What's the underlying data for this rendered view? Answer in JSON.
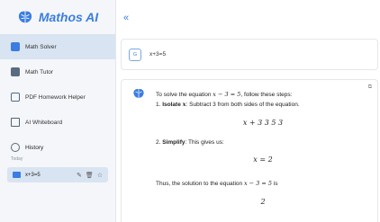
{
  "brand": {
    "name": "Mathos AI"
  },
  "toggle": {
    "symbol": "«"
  },
  "sidebar": {
    "items": [
      {
        "label": "Math Solver",
        "icon": "math-solver-icon",
        "active": true
      },
      {
        "label": "Math Tutor",
        "icon": "math-tutor-icon",
        "active": false
      },
      {
        "label": "PDF Homework Helper",
        "icon": "pdf-icon",
        "active": false
      },
      {
        "label": "AI Whiteboard",
        "icon": "whiteboard-icon",
        "active": false
      }
    ],
    "history": {
      "title": "History",
      "group": "Today",
      "entries": [
        {
          "label": "x+3=5"
        }
      ]
    }
  },
  "question": {
    "avatar": "G",
    "text": "x+3=5"
  },
  "answer": {
    "intro_prefix": "To solve the equation ",
    "intro_math": "x − 3 = 5",
    "intro_suffix": ", follow these steps:",
    "step1_num": "1.",
    "step1_bold": "Isolate",
    "step1_var": "x",
    "step1_text": ": Subtract 3 from both sides of the equation.",
    "eq1": "x + 3   3   5   3",
    "step2_num": "2.",
    "step2_bold": "Simplify",
    "step2_text": ": This gives us:",
    "eq2": "x = 2",
    "concl_prefix": "Thus, the solution to the equation ",
    "concl_math": "x − 3 = 5",
    "concl_suffix": " is",
    "eq3": "2"
  },
  "colors": {
    "accent": "#3b7de0",
    "active_bg": "#d9e4f3",
    "sidebar_bg": "#f4f6f9"
  }
}
